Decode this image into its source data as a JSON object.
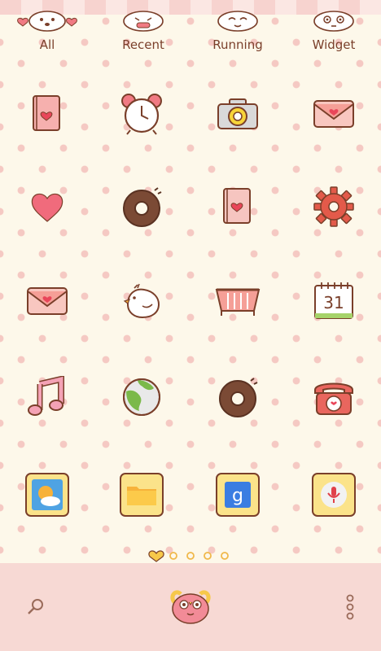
{
  "tabs": [
    {
      "label": "All",
      "icon": "dog-face-icon"
    },
    {
      "label": "Recent",
      "icon": "dog-face-icon"
    },
    {
      "label": "Running",
      "icon": "dog-face-icon"
    },
    {
      "label": "Widget",
      "icon": "dog-face-icon"
    }
  ],
  "apps": [
    {
      "icon": "book-heart-icon"
    },
    {
      "icon": "alarm-clock-icon"
    },
    {
      "icon": "camera-icon"
    },
    {
      "icon": "envelope-heart-icon"
    },
    {
      "icon": "heart-icon"
    },
    {
      "icon": "donut-icon"
    },
    {
      "icon": "book-heart-icon"
    },
    {
      "icon": "gear-icon"
    },
    {
      "icon": "envelope-heart-icon"
    },
    {
      "icon": "bird-icon"
    },
    {
      "icon": "basket-icon"
    },
    {
      "icon": "calendar-icon",
      "text": "31"
    },
    {
      "icon": "music-note-icon"
    },
    {
      "icon": "globe-icon"
    },
    {
      "icon": "donut-icon"
    },
    {
      "icon": "telephone-icon"
    },
    {
      "icon": "weather-icon"
    },
    {
      "icon": "folder-icon"
    },
    {
      "icon": "google-search-icon",
      "text": "g"
    },
    {
      "icon": "microphone-icon"
    }
  ],
  "pager": {
    "pages": 5,
    "current": 1
  },
  "dock": {
    "search": "search-icon",
    "home": "monster-icon",
    "menu": "more-vert-icon"
  },
  "colors": {
    "background": "#fdf8ea",
    "dots": "#f5c9c3",
    "dock": "#f7d9d4",
    "text": "#7a3f2a",
    "outline": "#7a3f2a"
  }
}
